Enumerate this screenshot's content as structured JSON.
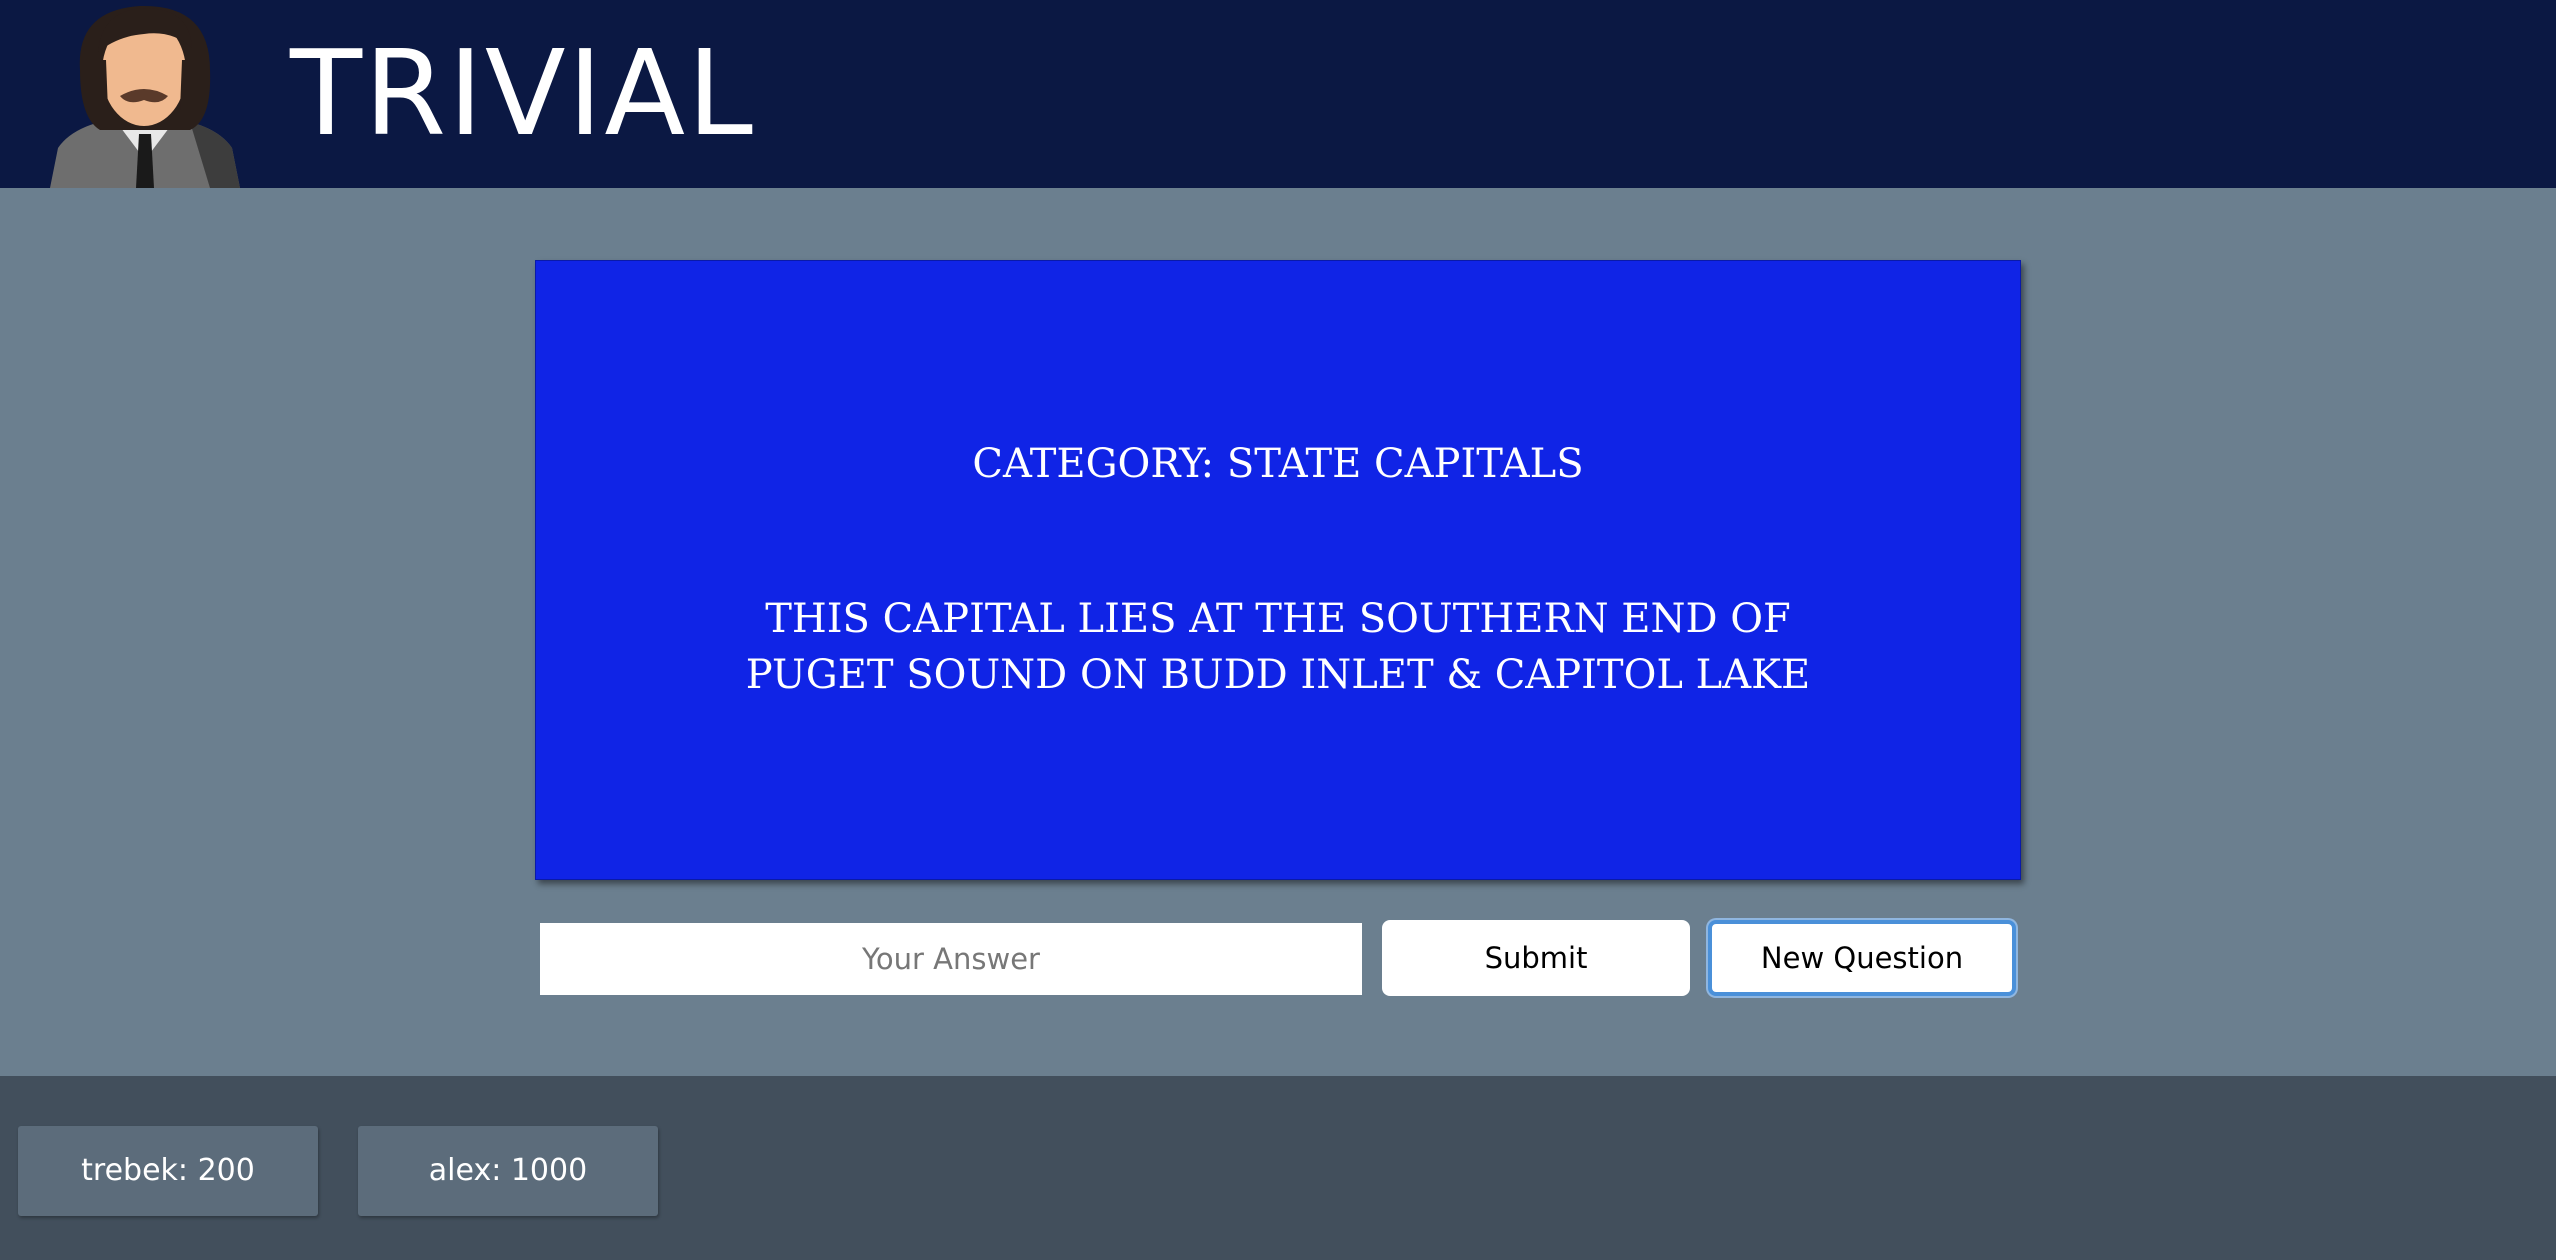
{
  "header": {
    "title": "TRIVIAL"
  },
  "question_card": {
    "category": "CATEGORY: STATE CAPITALS",
    "question": "THIS CAPITAL LIES AT THE SOUTHERN END OF PUGET SOUND ON BUDD INLET & CAPITOL LAKE"
  },
  "answer_form": {
    "placeholder": "Your Answer",
    "value": "",
    "submit_label": "Submit",
    "new_question_label": "New Question"
  },
  "scoreboard": {
    "players": [
      {
        "label": "trebek: 200"
      },
      {
        "label": "alex: 1000"
      }
    ]
  },
  "colors": {
    "header_bg": "#0b1843",
    "page_bg": "#6b7f8f",
    "card_bg": "#1024e6",
    "footer_bg": "#424f5c",
    "score_bg": "#5c6c7b",
    "focus_ring": "#4a90d9"
  },
  "icons": {
    "logo": "host-avatar-icon"
  }
}
